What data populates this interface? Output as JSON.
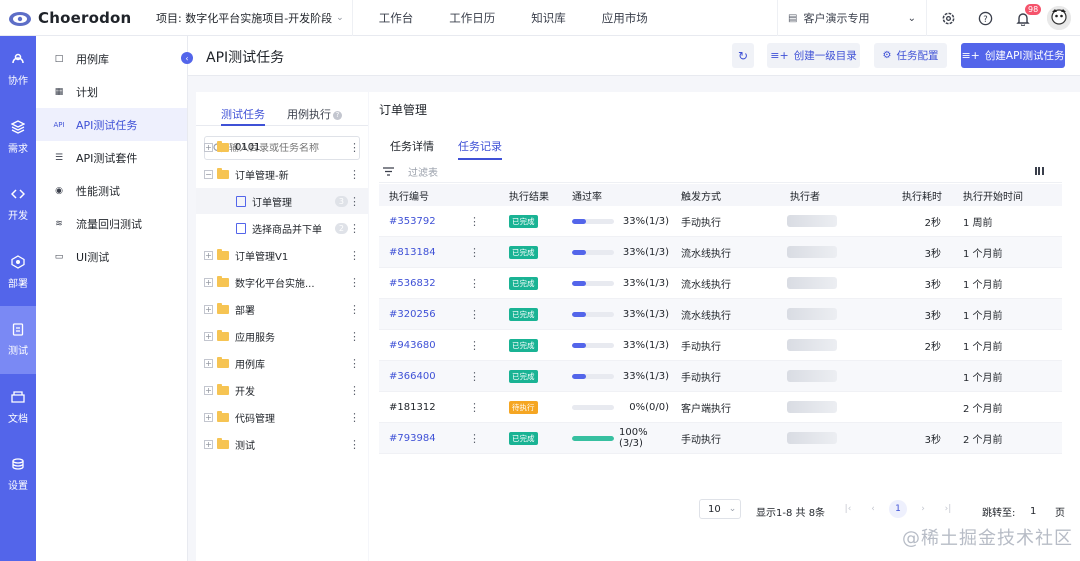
{
  "brand": {
    "name": "Choerodon"
  },
  "project": {
    "label": "项目: 数字化平台实施项目-开发阶段"
  },
  "topnav": [
    "工作台",
    "工作日历",
    "知识库",
    "应用市场"
  ],
  "org": {
    "label": "客户演示专用"
  },
  "notifications": {
    "count": "98"
  },
  "rail": [
    {
      "label": "协作",
      "icon": "collab-icon"
    },
    {
      "label": "需求",
      "icon": "layers-icon"
    },
    {
      "label": "开发",
      "icon": "code-icon"
    },
    {
      "label": "部署",
      "icon": "deploy-icon"
    },
    {
      "label": "测试",
      "icon": "test-icon"
    },
    {
      "label": "文档",
      "icon": "doc-icon"
    },
    {
      "label": "设置",
      "icon": "settings-icon"
    }
  ],
  "menu": [
    {
      "label": "用例库",
      "icon": "□"
    },
    {
      "label": "计划",
      "icon": "▦"
    },
    {
      "label": "API测试任务",
      "icon": "API"
    },
    {
      "label": "API测试套件",
      "icon": "☰"
    },
    {
      "label": "性能测试",
      "icon": "◉"
    },
    {
      "label": "流量回归测试",
      "icon": "≋"
    },
    {
      "label": "UI测试",
      "icon": "▭"
    }
  ],
  "header": {
    "title": "API测试任务",
    "btn_create_dir": "创建一级目录",
    "btn_config": "任务配置",
    "btn_create_task": "创建API测试任务"
  },
  "tree": {
    "tabs": [
      "测试任务",
      "用例执行"
    ],
    "search_placeholder": "输入目录或任务名称",
    "nodes": [
      {
        "label": "0101",
        "type": "folder"
      },
      {
        "label": "订单管理-新",
        "type": "folder",
        "expanded": true
      },
      {
        "label": "订单管理",
        "type": "task",
        "count": "3"
      },
      {
        "label": "选择商品并下单",
        "type": "task",
        "count": "2"
      },
      {
        "label": "订单管理V1",
        "type": "folder"
      },
      {
        "label": "数字化平台实施...",
        "type": "folder"
      },
      {
        "label": "部署",
        "type": "folder"
      },
      {
        "label": "应用服务",
        "type": "folder"
      },
      {
        "label": "用例库",
        "type": "folder"
      },
      {
        "label": "开发",
        "type": "folder"
      },
      {
        "label": "代码管理",
        "type": "folder"
      },
      {
        "label": "测试",
        "type": "folder"
      }
    ]
  },
  "panel": {
    "title": "订单管理",
    "tabs": [
      "任务详情",
      "任务记录"
    ],
    "filter_placeholder": "过滤表",
    "columns": [
      "执行编号",
      "执行结果",
      "通过率",
      "触发方式",
      "执行者",
      "执行耗时",
      "执行开始时间"
    ],
    "rows": [
      {
        "id": "#353792",
        "link": true,
        "result": "已完成",
        "status": "done",
        "rate": "33%(1/3)",
        "rate_value": 0.33,
        "trigger": "手动执行",
        "duration": "2秒",
        "start": "1 周前"
      },
      {
        "id": "#813184",
        "link": true,
        "result": "已完成",
        "status": "done",
        "rate": "33%(1/3)",
        "rate_value": 0.33,
        "trigger": "流水线执行",
        "duration": "3秒",
        "start": "1 个月前"
      },
      {
        "id": "#536832",
        "link": true,
        "result": "已完成",
        "status": "done",
        "rate": "33%(1/3)",
        "rate_value": 0.33,
        "trigger": "流水线执行",
        "duration": "3秒",
        "start": "1 个月前"
      },
      {
        "id": "#320256",
        "link": true,
        "result": "已完成",
        "status": "done",
        "rate": "33%(1/3)",
        "rate_value": 0.33,
        "trigger": "流水线执行",
        "duration": "3秒",
        "start": "1 个月前"
      },
      {
        "id": "#943680",
        "link": true,
        "result": "已完成",
        "status": "done",
        "rate": "33%(1/3)",
        "rate_value": 0.33,
        "trigger": "手动执行",
        "duration": "2秒",
        "start": "1 个月前"
      },
      {
        "id": "#366400",
        "link": true,
        "result": "已完成",
        "status": "done",
        "rate": "33%(1/3)",
        "rate_value": 0.33,
        "trigger": "手动执行",
        "duration": "",
        "start": "1 个月前"
      },
      {
        "id": "#181312",
        "link": false,
        "result": "待执行",
        "status": "wait",
        "rate": "0%(0/0)",
        "rate_value": 0,
        "trigger": "客户端执行",
        "duration": "",
        "start": "2 个月前"
      },
      {
        "id": "#793984",
        "link": true,
        "result": "已完成",
        "status": "done",
        "rate": "100%(3/3)",
        "rate_value": 1,
        "trigger": "手动执行",
        "duration": "3秒",
        "start": "2 个月前"
      }
    ],
    "pager": {
      "page_size": "10",
      "summary": "显示1-8 共 8条",
      "current": "1",
      "jump_label": "跳转至:",
      "jump_value": "1",
      "page_unit": "页"
    }
  },
  "watermark": "@稀土掘金技术社区"
}
